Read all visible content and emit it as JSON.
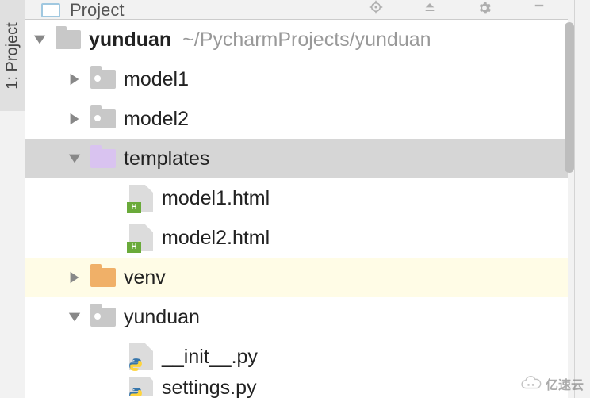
{
  "sideTab": {
    "label": "1: Project"
  },
  "topbar": {
    "title": "Project"
  },
  "tree": {
    "root": {
      "name": "yunduan",
      "path": "~/PycharmProjects/yunduan"
    },
    "items": [
      {
        "label": "model1"
      },
      {
        "label": "model2"
      },
      {
        "label": "templates"
      },
      {
        "label": "model1.html"
      },
      {
        "label": "model2.html"
      },
      {
        "label": "venv"
      },
      {
        "label": "yunduan"
      },
      {
        "label": "__init__.py"
      },
      {
        "label": "settings.py"
      }
    ]
  },
  "watermark": {
    "text": "亿速云"
  }
}
